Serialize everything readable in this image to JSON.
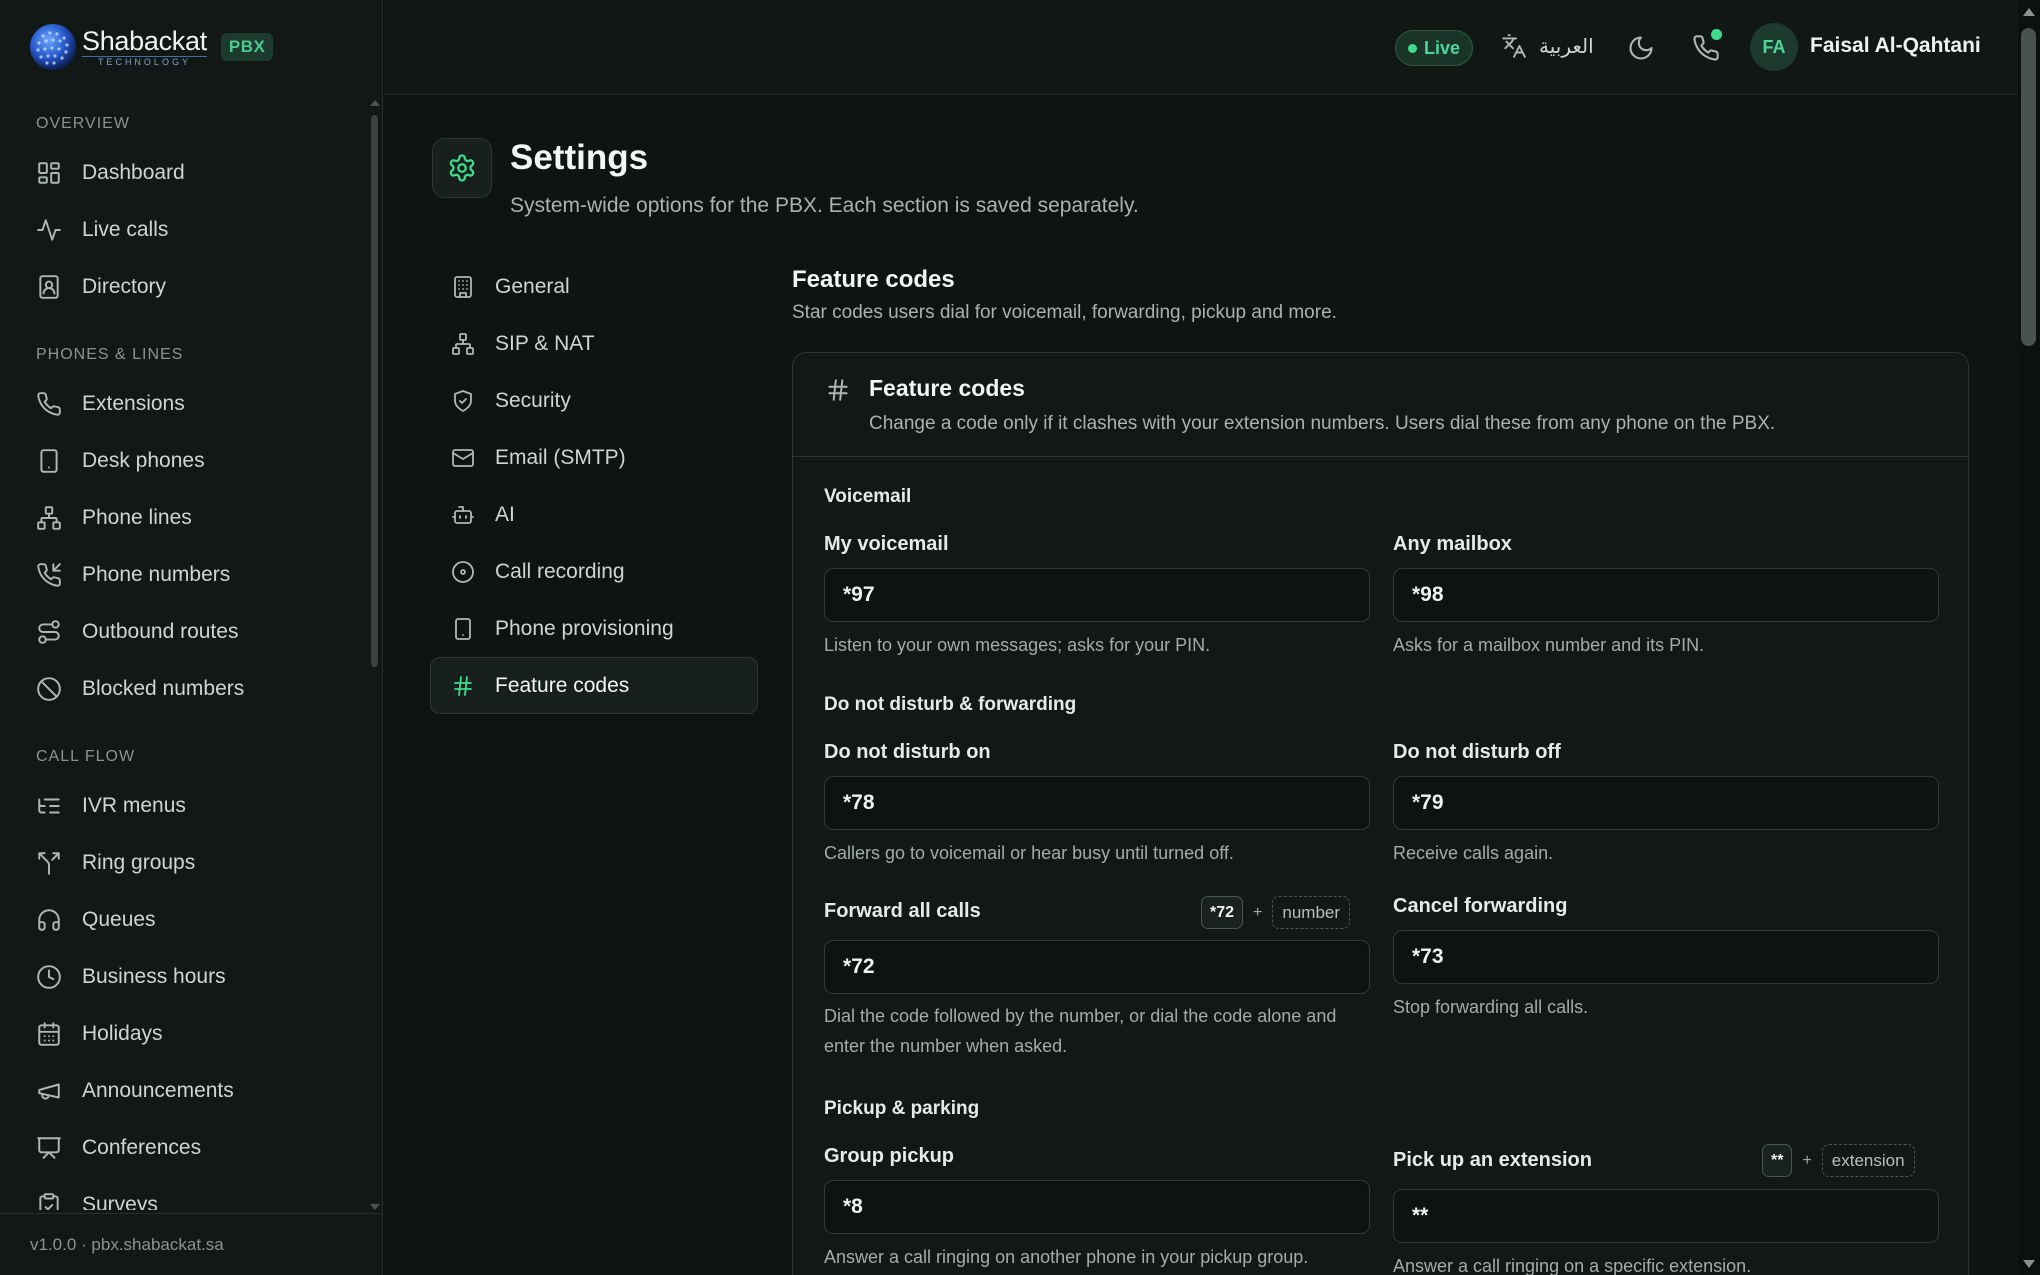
{
  "brand": {
    "name": "Shabackat",
    "tagline": "TECHNOLOGY",
    "badge": "PBX"
  },
  "sidebar": {
    "groups": [
      {
        "title": "OVERVIEW",
        "items": [
          {
            "label": "Dashboard",
            "icon": "dashboard-icon"
          },
          {
            "label": "Live calls",
            "icon": "activity-icon"
          },
          {
            "label": "Directory",
            "icon": "contact-icon"
          }
        ]
      },
      {
        "title": "PHONES & LINES",
        "items": [
          {
            "label": "Extensions",
            "icon": "phone-icon"
          },
          {
            "label": "Desk phones",
            "icon": "smartphone-icon"
          },
          {
            "label": "Phone lines",
            "icon": "network-icon"
          },
          {
            "label": "Phone numbers",
            "icon": "phone-incoming-icon"
          },
          {
            "label": "Outbound routes",
            "icon": "route-icon"
          },
          {
            "label": "Blocked numbers",
            "icon": "ban-icon"
          }
        ]
      },
      {
        "title": "CALL FLOW",
        "items": [
          {
            "label": "IVR menus",
            "icon": "list-tree-icon"
          },
          {
            "label": "Ring groups",
            "icon": "split-icon"
          },
          {
            "label": "Queues",
            "icon": "headphones-icon"
          },
          {
            "label": "Business hours",
            "icon": "clock-icon"
          },
          {
            "label": "Holidays",
            "icon": "calendar-icon"
          },
          {
            "label": "Announcements",
            "icon": "megaphone-icon"
          },
          {
            "label": "Conferences",
            "icon": "presentation-icon"
          },
          {
            "label": "Surveys",
            "icon": "clipboard-check-icon"
          }
        ]
      }
    ],
    "footer": "v1.0.0 · pbx.shabackat.sa"
  },
  "topbar": {
    "live": "Live",
    "language": "العربية",
    "avatar_initials": "FA",
    "user_name": "Faisal Al-Qahtani"
  },
  "page": {
    "title": "Settings",
    "subtitle": "System-wide options for the PBX. Each section is saved separately."
  },
  "subnav": [
    {
      "label": "General",
      "icon": "building-icon"
    },
    {
      "label": "SIP & NAT",
      "icon": "network-icon"
    },
    {
      "label": "Security",
      "icon": "shield-icon"
    },
    {
      "label": "Email (SMTP)",
      "icon": "mail-icon"
    },
    {
      "label": "AI",
      "icon": "bot-icon"
    },
    {
      "label": "Call recording",
      "icon": "disc-icon"
    },
    {
      "label": "Phone provisioning",
      "icon": "smartphone-icon"
    },
    {
      "label": "Feature codes",
      "icon": "hash-icon",
      "active": true
    }
  ],
  "section": {
    "title": "Feature codes",
    "subtitle": "Star codes users dial for voicemail, forwarding, pickup and more."
  },
  "card": {
    "title": "Feature codes",
    "description": "Change a code only if it clashes with your extension numbers. Users dial these from any phone on the PBX.",
    "groups": {
      "voicemail": "Voicemail",
      "dnd": "Do not disturb & forwarding",
      "pickup": "Pickup & parking"
    },
    "fields": {
      "my_voicemail": {
        "label": "My voicemail",
        "value": "*97",
        "help": "Listen to your own messages; asks for your PIN."
      },
      "any_mailbox": {
        "label": "Any mailbox",
        "value": "*98",
        "help": "Asks for a mailbox number and its PIN."
      },
      "dnd_on": {
        "label": "Do not disturb on",
        "value": "*78",
        "help": "Callers go to voicemail or hear busy until turned off."
      },
      "dnd_off": {
        "label": "Do not disturb off",
        "value": "*79",
        "help": "Receive calls again."
      },
      "forward_all": {
        "label": "Forward all calls",
        "value": "*72",
        "help": "Dial the code followed by the number, or dial the code alone and enter the number when asked.",
        "hint_code": "*72",
        "hint_plus": "+",
        "hint_slot": "number"
      },
      "cancel_forward": {
        "label": "Cancel forwarding",
        "value": "*73",
        "help": "Stop forwarding all calls."
      },
      "group_pickup": {
        "label": "Group pickup",
        "value": "*8",
        "help": "Answer a call ringing on another phone in your pickup group."
      },
      "pickup_ext": {
        "label": "Pick up an extension",
        "value": "**",
        "help": "Answer a call ringing on a specific extension.",
        "hint_code": "**",
        "hint_plus": "+",
        "hint_slot": "extension"
      }
    }
  },
  "colors": {
    "accent": "#3ddc8e",
    "background": "#0f1412",
    "panel": "#121816"
  }
}
